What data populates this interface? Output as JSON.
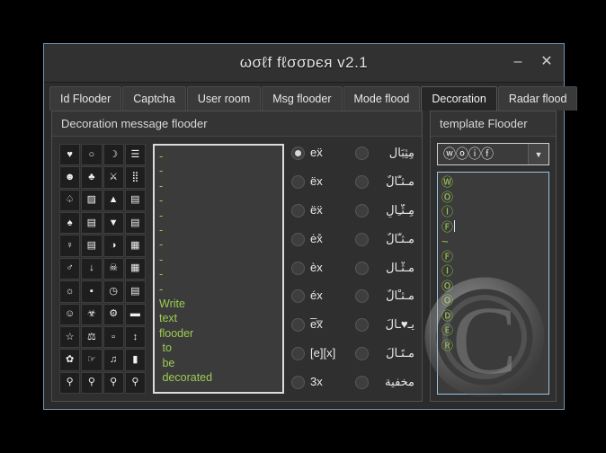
{
  "window": {
    "title": "ωσℓf fℓσσᴅєя v2.1",
    "minimize_label": "–",
    "close_label": "✕"
  },
  "tabs": [
    {
      "label": "Id Flooder",
      "active": false
    },
    {
      "label": "Captcha",
      "active": false
    },
    {
      "label": "User room",
      "active": false
    },
    {
      "label": "Msg flooder",
      "active": false
    },
    {
      "label": "Mode flood",
      "active": false
    },
    {
      "label": "Decoration",
      "active": true
    },
    {
      "label": "Radar flood",
      "active": false
    }
  ],
  "decoration_panel": {
    "header": "Decoration message flooder",
    "symbols": [
      "♥",
      "○",
      "☽",
      "☰",
      "☻",
      "♣",
      "⚔",
      "⣿",
      "♤",
      "▨",
      "▲",
      "▤",
      "♠",
      "▤",
      "▼",
      "▤",
      "♀",
      "▤",
      "◑",
      "▦",
      "♂",
      "↓",
      "☠",
      "▦",
      "☼",
      "▪",
      "◷",
      "▤",
      "☺",
      "☣",
      "⚙",
      "▬",
      "☆",
      "⚖",
      "▫",
      "↕",
      "✿",
      "☞",
      "♫",
      "▮",
      "⚲",
      "⚲",
      "⚲",
      "⚲"
    ],
    "message_text": "-\n-\n-\n-\n-\n-\n-\n-\n-\n-\nWrite\ntext\nflooder\n to\n be\n decorated",
    "styles_left": [
      {
        "label": "eẍ",
        "checked": true
      },
      {
        "label": "ëx",
        "checked": false
      },
      {
        "label": "ëẍ",
        "checked": false
      },
      {
        "label": "ėx̊",
        "checked": false
      },
      {
        "label": "èx",
        "checked": false
      },
      {
        "label": "éx",
        "checked": false
      },
      {
        "label": "e̅x̅",
        "checked": false
      },
      {
        "label": "[e][x]",
        "checked": false
      },
      {
        "label": "3x",
        "checked": false
      }
    ],
    "styles_right": [
      {
        "label": "مِثِبَال",
        "checked": false
      },
      {
        "label": "مـثـَّالٌ",
        "checked": false
      },
      {
        "label": "مِـثّـِالٍ",
        "checked": false
      },
      {
        "label": "مـثـّالٌ",
        "checked": false
      },
      {
        "label": "مـثْـالٍ",
        "checked": false
      },
      {
        "label": "مـثـْالٌ",
        "checked": false
      },
      {
        "label": "يـ♥ـآلَ",
        "checked": false
      },
      {
        "label": "مـتَـآلَ",
        "checked": false
      },
      {
        "label": "مخفية",
        "checked": false
      }
    ]
  },
  "template_panel": {
    "header": "template Flooder",
    "combo_value": "ⓦⓞⓘⓕ",
    "combo_arrow": "▼",
    "list_items": [
      "Ⓦ",
      "Ⓞ",
      "Ⓘ",
      "Ⓕ",
      "~",
      "Ⓕ",
      "Ⓘ",
      "Ⓞ",
      "Ⓞ",
      "Ⓓ",
      "Ⓔ",
      "Ⓡ"
    ],
    "caret_index": 3
  },
  "colors": {
    "accent_green": "#9ccc52",
    "window_border": "#6f93b0",
    "title_bar": "#313131",
    "panel_bg": "#2f2f2f"
  },
  "watermark": {
    "glyph": "copyright-watermark"
  }
}
